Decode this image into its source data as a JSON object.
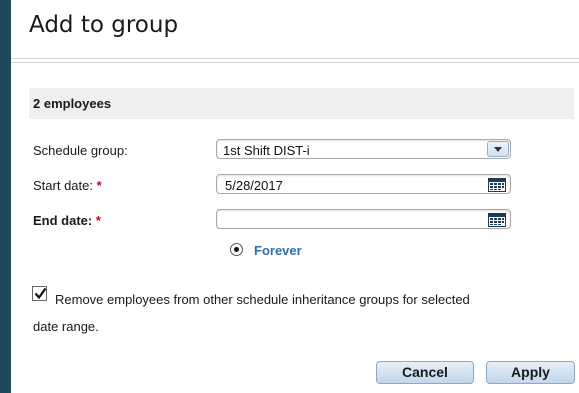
{
  "dialog": {
    "title": "Add to group",
    "employee_count": "2 employees"
  },
  "form": {
    "schedule_group_label": "Schedule group:",
    "schedule_group_value": "1st Shift DIST-i",
    "start_date_label": "Start date:",
    "start_date_value": "5/28/2017",
    "end_date_label": "End date:",
    "end_date_value": "",
    "required_marker": "*",
    "forever_label": "Forever",
    "forever_selected": true,
    "remove_checkbox_checked": true,
    "remove_label_line1": "Remove employees from other schedule inheritance groups for selected",
    "remove_label_line2": "date range."
  },
  "buttons": {
    "cancel": "Cancel",
    "apply": "Apply"
  },
  "icons": {
    "dropdown": "chevron-down-icon",
    "calendar": "calendar-icon",
    "checkbox": "check-icon"
  },
  "colors": {
    "required": "#d0021b",
    "link": "#2f6fa6",
    "frame": "#1f4a5e"
  }
}
